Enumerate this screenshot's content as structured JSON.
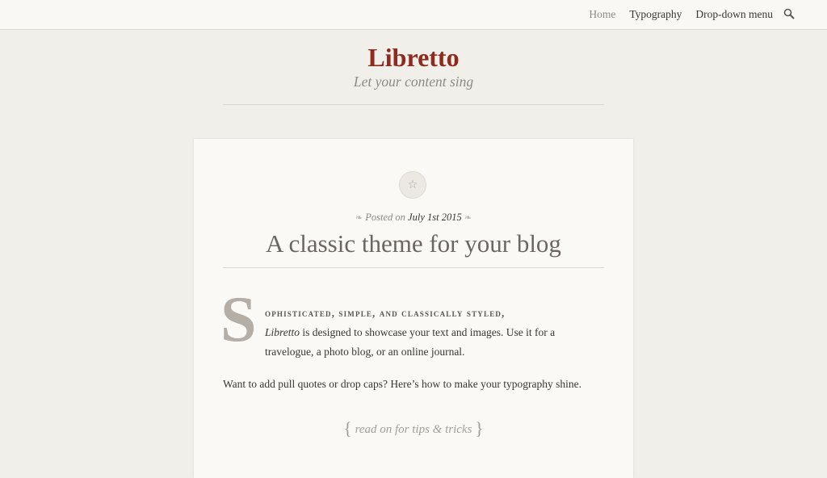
{
  "nav": {
    "items": [
      "Home",
      "Typography",
      "Drop-down menu"
    ],
    "search_icon": "search-icon"
  },
  "site": {
    "title": "Libretto",
    "tagline": "Let your content sing"
  },
  "post": {
    "badge_icon": "star-icon",
    "posted_prefix": "Posted on",
    "posted_date": "July 1st 2015",
    "title": "A classic theme for your blog",
    "drop_cap": "S",
    "lead": "ophisticated, simple, and classically styled,",
    "intro_em": "Libretto",
    "intro_rest": " is designed to showcase your text and images. Use it for a travelogue, a photo blog, or an online journal.",
    "paragraph2": "Want to add pull quotes or drop caps? Here’s how to make your typography shine.",
    "read_more": "read on for tips & tricks"
  },
  "colors": {
    "background": "#f1efea",
    "card": "#faf9f6",
    "title_red": "#8f2a1f",
    "muted": "#8e8a84"
  }
}
